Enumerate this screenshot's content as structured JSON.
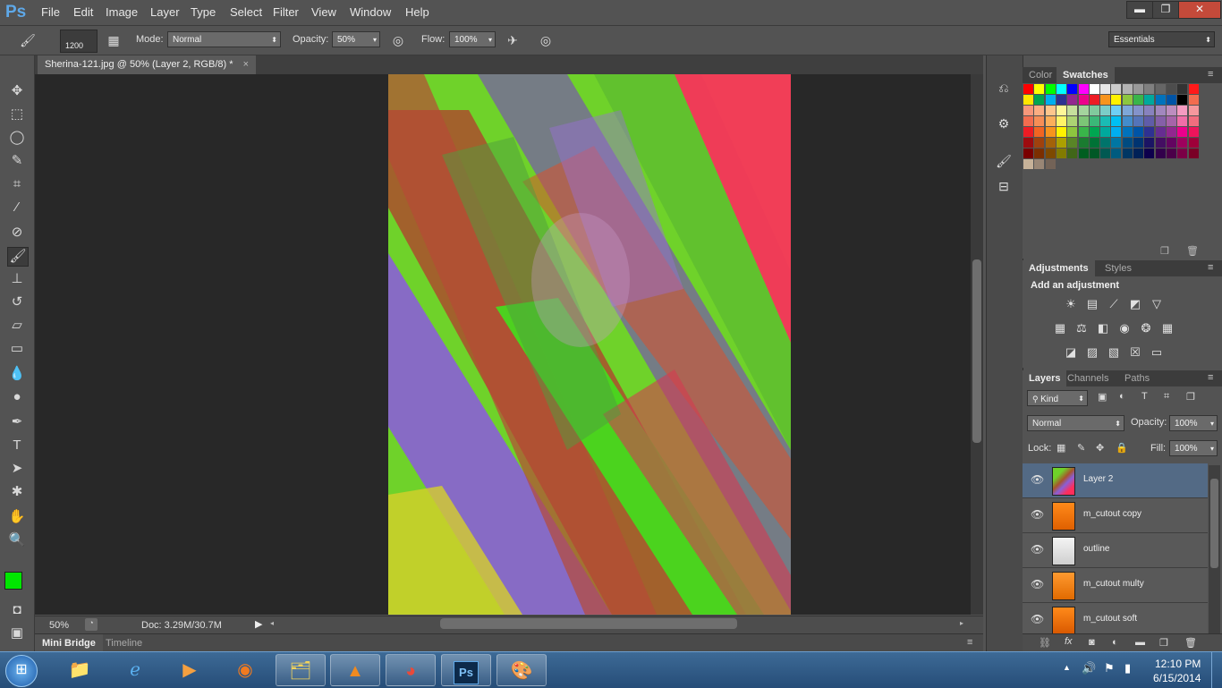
{
  "app": {
    "logo": "Ps",
    "workspace": "Essentials"
  },
  "menu": [
    "File",
    "Edit",
    "Image",
    "Layer",
    "Type",
    "Select",
    "Filter",
    "View",
    "Window",
    "Help"
  ],
  "window_controls": {
    "minimize": "▬",
    "restore": "❐",
    "close": "✕"
  },
  "options_bar": {
    "brush_size": "1200",
    "mode_label": "Mode:",
    "mode_value": "Normal",
    "opacity_label": "Opacity:",
    "opacity_value": "50%",
    "flow_label": "Flow:",
    "flow_value": "100%"
  },
  "document": {
    "tab_title": "Sherina-121.jpg @ 50% (Layer 2, RGB/8) *",
    "zoom": "50%",
    "doc_size": "Doc: 3.29M/30.7M"
  },
  "bottom_tabs": [
    "Mini Bridge",
    "Timeline"
  ],
  "color_panel": {
    "tabs": [
      "Color",
      "Swatches"
    ],
    "active": "Swatches"
  },
  "adjustments_panel": {
    "tabs": [
      "Adjustments",
      "Styles"
    ],
    "heading": "Add an adjustment"
  },
  "layers_panel": {
    "tabs": [
      "Layers",
      "Channels",
      "Paths"
    ],
    "filter_kind": "Kind",
    "blend_mode": "Normal",
    "opacity_label": "Opacity:",
    "opacity_value": "100%",
    "lock_label": "Lock:",
    "fill_label": "Fill:",
    "fill_value": "100%",
    "layers": [
      {
        "name": "Layer 2",
        "selected": true
      },
      {
        "name": "m_cutout copy",
        "selected": false
      },
      {
        "name": "outline",
        "selected": false
      },
      {
        "name": "m_cutout multy",
        "selected": false
      },
      {
        "name": "m_cutout soft",
        "selected": false
      }
    ]
  },
  "foreground_color": "#00e600",
  "background_color": "#ffffff",
  "taskbar": {
    "time": "12:10 PM",
    "date": "6/15/2014",
    "apps": [
      "explorer-libraries",
      "internet-explorer",
      "media-player",
      "firefox",
      "file-explorer",
      "vlc",
      "chrome",
      "photoshop",
      "paint"
    ]
  }
}
